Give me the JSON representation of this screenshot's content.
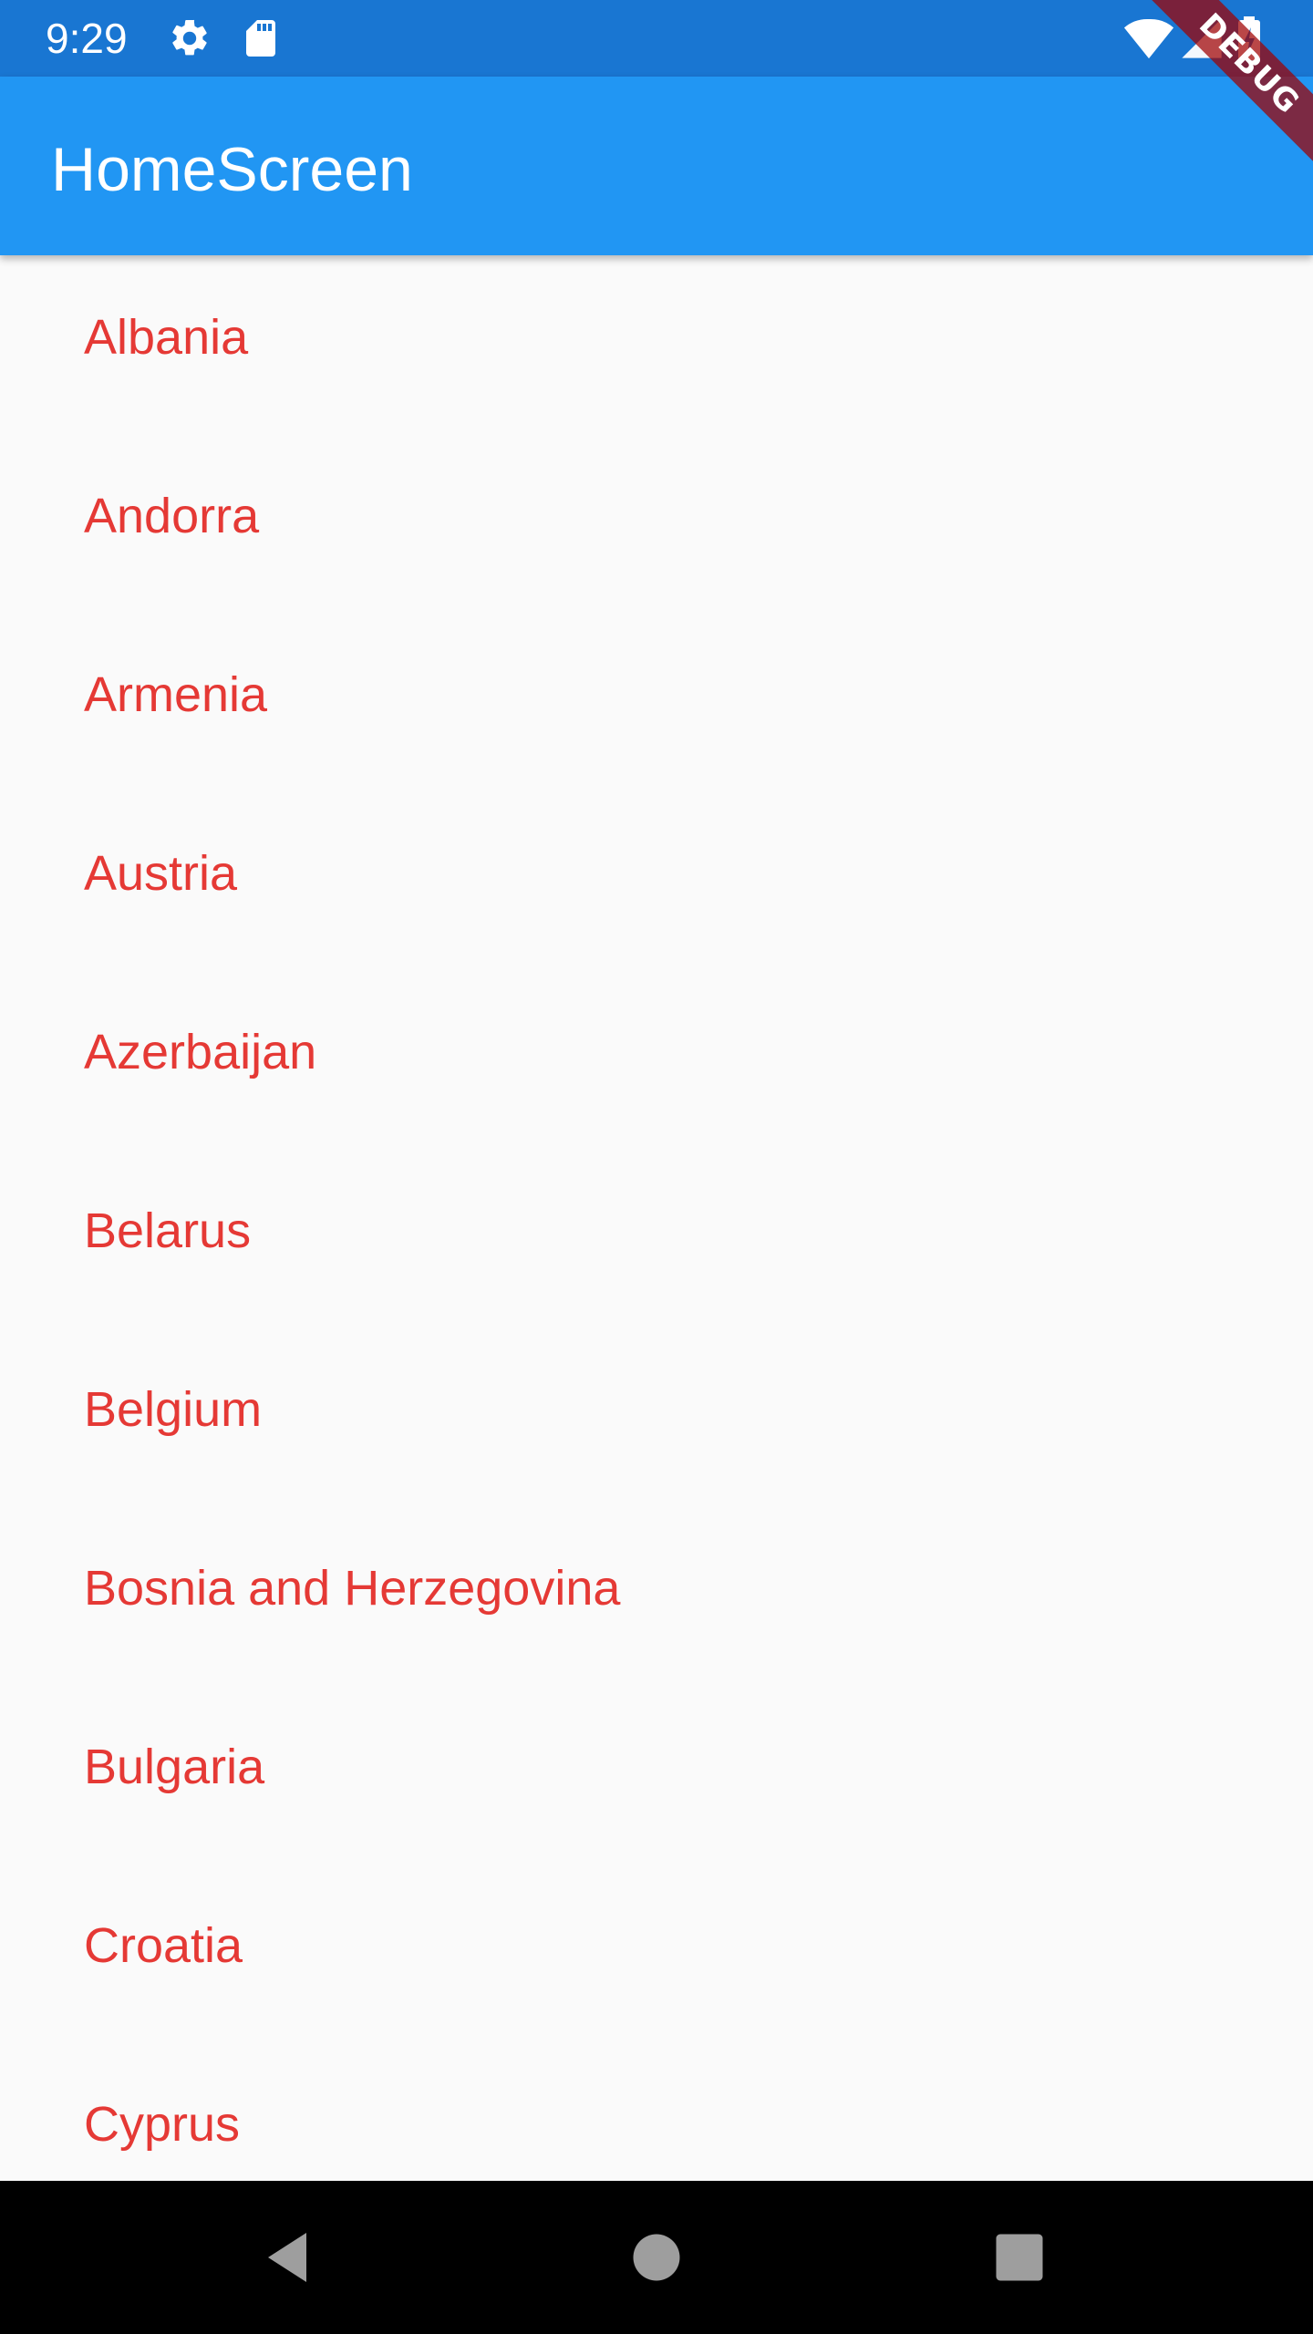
{
  "status_bar": {
    "time": "9:29",
    "left_icons": [
      "gear-icon",
      "sd-card-icon"
    ],
    "right_icons": [
      "wifi-icon",
      "cell-signal-icon",
      "battery-charging-icon"
    ]
  },
  "app_bar": {
    "title": "HomeScreen"
  },
  "debug_banner": {
    "label": "DEBUG"
  },
  "countries": [
    {
      "name": "Albania"
    },
    {
      "name": "Andorra"
    },
    {
      "name": "Armenia"
    },
    {
      "name": "Austria"
    },
    {
      "name": "Azerbaijan"
    },
    {
      "name": "Belarus"
    },
    {
      "name": "Belgium"
    },
    {
      "name": "Bosnia and Herzegovina"
    },
    {
      "name": "Bulgaria"
    },
    {
      "name": "Croatia"
    },
    {
      "name": "Cyprus"
    }
  ],
  "nav_bar": {
    "buttons": [
      "back-icon",
      "home-icon",
      "recents-icon"
    ]
  },
  "colors": {
    "status_bar": "#1976d2",
    "app_bar": "#2196f3",
    "list_text": "#e53935",
    "background": "#fafafa",
    "nav_bar": "#000000"
  }
}
